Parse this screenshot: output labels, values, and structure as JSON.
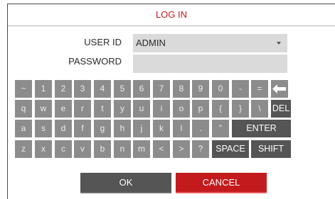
{
  "dialog": {
    "title": "LOG IN"
  },
  "form": {
    "user_id_label": "USER ID",
    "user_id_value": "ADMIN",
    "password_label": "PASSWORD",
    "password_value": ""
  },
  "keyboard": {
    "row1": [
      "~",
      "1",
      "2",
      "3",
      "4",
      "5",
      "6",
      "7",
      "8",
      "9",
      "0",
      "-",
      "=",
      "backspace"
    ],
    "row2": [
      "q",
      "w",
      "e",
      "r",
      "t",
      "y",
      "u",
      "i",
      "o",
      "p",
      "{",
      "}",
      "\\",
      "DEL"
    ],
    "row3": [
      "a",
      "s",
      "d",
      "f",
      "g",
      "h",
      "j",
      "k",
      "l",
      ".",
      "\"",
      "ENTER"
    ],
    "row4": [
      "z",
      "x",
      "c",
      "v",
      "b",
      "n",
      "m",
      "<",
      ">",
      "?",
      "SPACE",
      "SHIFT"
    ]
  },
  "buttons": {
    "ok": "OK",
    "cancel": "CANCEL"
  },
  "colors": {
    "accent": "#c8171c",
    "key_light": "#8c8c8c",
    "key_dark": "#555555"
  }
}
